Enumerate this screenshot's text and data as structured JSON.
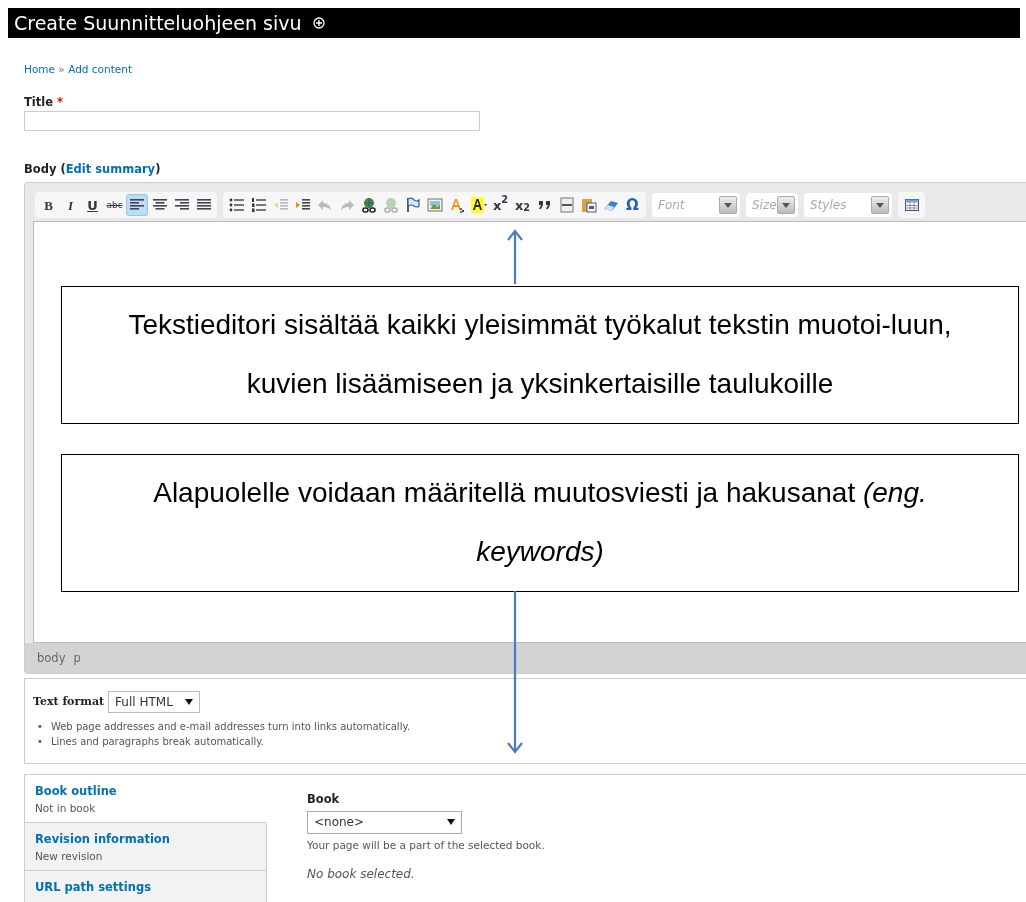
{
  "page_title": "Create Suunnitteluohjeen sivu",
  "breadcrumb": [
    {
      "label": "Home"
    },
    {
      "label": "Add content"
    }
  ],
  "breadcrumb_separator": "»",
  "title_field": {
    "label": "Title",
    "required_mark": "*"
  },
  "body_field": {
    "label": "Body",
    "link_prefix": "(",
    "link": "Edit summary",
    "link_suffix": ")"
  },
  "toolbar": {
    "text_buttons": [
      {
        "label": "B"
      },
      {
        "label": "I"
      },
      {
        "label": "U"
      },
      {
        "label": "abc"
      }
    ],
    "alignment": [
      {
        "selected": true
      },
      {
        "selected": false
      },
      {
        "selected": false
      },
      {
        "selected": false
      }
    ],
    "icon_buttons": [
      {
        "disabled": false
      },
      {
        "disabled": false
      },
      {
        "disabled": true
      },
      {
        "disabled": false
      },
      {
        "disabled": true
      },
      {
        "disabled": true
      },
      {
        "disabled": false
      },
      {
        "disabled": true
      },
      {
        "disabled": false
      },
      {
        "disabled": false
      },
      {
        "disabled": false
      },
      {
        "disabled": false
      }
    ],
    "script_buttons": [
      {
        "label": "x$^{2}$"
      },
      {
        "label": "x$_{2}$"
      }
    ],
    "special_char": "Ω",
    "combos": [
      {
        "placeholder": "Font"
      },
      {
        "placeholder": "Size"
      },
      {
        "placeholder": "Styles"
      }
    ]
  },
  "editor_path": [
    "body",
    "p"
  ],
  "annotations": [
    {
      "text": "Tekstieditori sisältää kaikki yleisimmät työkalut tekstin muotoi-luun, kuvien lisäämiseen ja yksinkertaisille taulukoille"
    },
    {
      "text": "Alapuolelle voidaan määritellä muutosviesti ja hakusanat *(eng. keywords)*"
    }
  ],
  "text_format": {
    "label": "Text format",
    "value": "Full HTML",
    "tip_marker": "•",
    "tips": [
      "Web page addresses and e-mail addresses turn into links automatically.",
      "Lines and paragraphs break automatically."
    ]
  },
  "vertical_tabs": [
    {
      "title": "Book outline",
      "summary": "Not in book",
      "selected": true
    },
    {
      "title": "Revision information",
      "summary": "New revision",
      "selected": false
    },
    {
      "title": "URL path settings",
      "selected": false
    }
  ],
  "book_pane": {
    "label": "Book",
    "value": "<none>",
    "description": "Your page will be a part of the selected book.",
    "note": "No book selected."
  }
}
